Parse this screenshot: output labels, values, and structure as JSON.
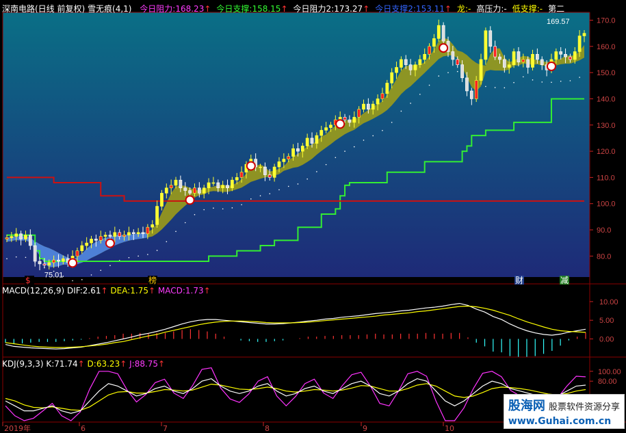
{
  "header": {
    "title": "深南电路(日线 前复权)",
    "indicator": "雪无痕(4,1)",
    "items": [
      {
        "label": "今日阻力:",
        "value": "168.23",
        "arrow": "↑",
        "color": "#ff3cff"
      },
      {
        "label": "今日支撑:",
        "value": "158.15",
        "arrow": "↑",
        "color": "#33ff33"
      },
      {
        "label": "今日阻力2:",
        "value": "173.27",
        "arrow": "↑",
        "color": "#ffffff"
      },
      {
        "label": "今日支撑2:",
        "value": "153.11",
        "arrow": "↑",
        "color": "#3366ff"
      },
      {
        "label": "龙:",
        "value": "-",
        "arrow": "",
        "color": "#ffff00"
      },
      {
        "label": "高压力:",
        "value": "-",
        "arrow": "",
        "color": "#ffffff"
      },
      {
        "label": "低支撑:",
        "value": "-",
        "arrow": "",
        "color": "#ffff00"
      },
      {
        "label": "第二",
        "value": "",
        "arrow": "",
        "color": "#ffffff"
      }
    ]
  },
  "macd_header": {
    "name": "MACD(12,26,9)",
    "dif_label": "DIF:",
    "dif": "2.61",
    "dea_label": "DEA:",
    "dea": "1.75",
    "macd_label": "MACD:",
    "macd": "1.73"
  },
  "kdj_header": {
    "name": "KDJ(9,3,3)",
    "k_label": "K:",
    "k": "71.74",
    "d_label": "D:",
    "d": "63.23",
    "j_label": "J:",
    "j": "88.75"
  },
  "annotations": {
    "max_label": "169.57",
    "min_label": "75.01",
    "bang": "榜",
    "cai": "财",
    "jian": "减",
    "ren": "$"
  },
  "xaxis_labels": [
    "2019年",
    "6",
    "7",
    "8",
    "9",
    "10"
  ],
  "watermark": {
    "brand": "股海网",
    "slogan": "股票软件资源分享",
    "url": "www.Guhai.com.cn"
  },
  "colors": {
    "up": "#ff3333",
    "down": "#33ffff",
    "ma": "#ffffff",
    "resist": "#cc1111",
    "support": "#33ee33",
    "cloud": "#9b9b19",
    "cloud_blue": "#4a7fe0",
    "bg_top": "#0a6f86",
    "bg_bottom": "#1e2a78"
  },
  "chart_data": [
    {
      "type": "candlestick",
      "title": "深南电路(日线 前复权)",
      "yticks": [
        80,
        90,
        100,
        110,
        120,
        130,
        140,
        150,
        160,
        170
      ],
      "ylim": [
        72,
        173
      ],
      "close": [
        87,
        87.5,
        88.5,
        86.5,
        88,
        84,
        78,
        77,
        76.5,
        77.5,
        78.5,
        78,
        79,
        77.5,
        80,
        82,
        84,
        85,
        86.5,
        86,
        87.5,
        88,
        87.5,
        89,
        87.5,
        88,
        89,
        88.5,
        89,
        88.5,
        91,
        92,
        99,
        104,
        106,
        107,
        109,
        106,
        105,
        104,
        106,
        104,
        106,
        108,
        108,
        106,
        107,
        106,
        109,
        110,
        112,
        115,
        117,
        114,
        114,
        111,
        110,
        114,
        116,
        117,
        118,
        121,
        120,
        122,
        125,
        123,
        126,
        128,
        129,
        130,
        132,
        133,
        132,
        131,
        133,
        136,
        138,
        136,
        138,
        140,
        142,
        146,
        150,
        152,
        155,
        153,
        151,
        153,
        155,
        157,
        160,
        163,
        168,
        162,
        158,
        155,
        153,
        148,
        143,
        140,
        147,
        155,
        166,
        160,
        156,
        155,
        152,
        153,
        158,
        154,
        155,
        152,
        157,
        155,
        153,
        151,
        155,
        158,
        157,
        156,
        155,
        158,
        164,
        165
      ],
      "support_line": [
        88,
        88,
        88,
        88,
        88,
        88,
        82,
        79,
        78,
        78,
        78,
        78,
        78,
        78,
        78,
        78,
        78,
        78,
        78,
        78,
        78,
        78,
        78,
        78,
        78,
        78,
        78,
        78,
        78,
        78,
        78,
        78,
        78,
        78,
        78,
        78,
        78,
        78,
        78,
        78,
        78,
        78,
        78,
        80,
        80,
        80,
        80,
        80,
        80,
        82,
        82,
        82,
        82,
        82,
        84,
        84,
        84,
        86,
        86,
        86,
        86,
        86,
        91,
        91,
        91,
        91,
        91,
        96,
        96,
        96,
        98,
        103,
        107,
        108,
        108,
        108,
        108,
        108,
        108,
        108,
        108,
        112,
        112,
        112,
        112,
        112,
        112,
        112,
        112,
        116,
        116,
        116,
        116,
        116,
        116,
        116,
        116,
        120,
        122,
        126,
        126,
        126,
        128,
        128,
        128,
        128,
        128,
        128,
        131,
        131,
        131,
        131,
        131,
        131,
        131,
        131,
        140,
        140,
        140,
        140,
        140,
        140,
        140,
        140,
        140,
        140,
        140,
        140,
        140,
        140,
        140
      ],
      "resist_line": [
        110,
        110,
        110,
        110,
        110,
        110,
        110,
        110,
        110,
        110,
        108,
        108,
        108,
        108,
        108,
        108,
        108,
        108,
        108,
        108,
        103,
        103,
        103,
        103,
        103,
        101,
        101,
        101,
        101,
        101,
        101,
        101,
        101,
        101,
        101,
        101,
        101,
        101,
        101,
        101,
        101,
        101,
        101,
        101,
        101,
        101,
        101,
        101,
        101,
        101,
        101,
        101,
        101,
        101,
        101,
        101,
        101,
        101,
        101,
        101,
        101,
        101,
        101,
        101,
        101,
        101,
        101,
        101,
        101,
        101,
        101,
        101,
        101,
        101,
        101,
        101,
        101,
        101,
        101,
        101,
        101,
        101,
        101,
        101,
        101,
        101,
        101,
        101,
        101,
        101,
        101,
        101,
        101,
        101,
        101,
        101,
        101,
        101,
        101,
        101,
        101,
        101,
        101,
        101,
        101,
        101,
        101,
        101,
        101,
        101,
        101,
        101,
        101,
        101,
        101,
        101,
        101,
        101,
        101,
        101,
        101,
        101,
        101,
        101,
        101
      ],
      "xlabels": [
        "2019年",
        "6",
        "7",
        "8",
        "9",
        "10"
      ]
    },
    {
      "type": "bar",
      "title": "MACD(12,26,9)",
      "yticks": [
        0,
        5,
        10
      ],
      "ylim": [
        -4.5,
        12
      ],
      "dif": [
        -1.5,
        -2,
        -2.2,
        -2.4,
        -2.5,
        -2.6,
        -2.7,
        -2.6,
        -2.4,
        -2.2,
        -1.8,
        -1.4,
        -1,
        -0.5,
        0,
        0.5,
        1.1,
        1.5,
        2,
        2.6,
        3.3,
        4,
        4.6,
        5,
        5.2,
        5.2,
        5,
        4.8,
        4.6,
        4.4,
        4.2,
        4,
        4,
        4.1,
        4.3,
        4.5,
        4.8,
        5,
        5.3,
        5.5,
        5.8,
        6,
        6.2,
        6.5,
        6.8,
        7,
        7.2,
        7.5,
        7.7,
        8,
        8.3,
        8.5,
        8.8,
        9.2,
        9.5,
        9,
        8,
        7.2,
        6,
        5.2,
        4,
        3,
        2.2,
        1.6,
        1.2,
        1,
        1.3,
        1.8,
        2.2,
        2.6
      ],
      "dea": [
        -1,
        -1.3,
        -1.6,
        -1.9,
        -2.1,
        -2.2,
        -2.3,
        -2.3,
        -2.2,
        -2.1,
        -1.9,
        -1.7,
        -1.4,
        -1,
        -0.7,
        -0.2,
        0.3,
        0.8,
        1.2,
        1.8,
        2.3,
        2.8,
        3.3,
        3.8,
        4.2,
        4.5,
        4.7,
        4.8,
        4.8,
        4.7,
        4.6,
        4.4,
        4.3,
        4.3,
        4.3,
        4.4,
        4.5,
        4.7,
        4.9,
        5.1,
        5.3,
        5.5,
        5.7,
        5.9,
        6.1,
        6.4,
        6.6,
        6.8,
        7,
        7.3,
        7.5,
        7.8,
        8.1,
        8.4,
        8.7,
        8.8,
        8.6,
        8.2,
        7.7,
        7,
        6.3,
        5.4,
        4.6,
        3.9,
        3.2,
        2.6,
        2.2,
        2,
        1.9,
        1.75
      ],
      "macd": [
        -1,
        -1.4,
        -1.2,
        -1,
        -0.8,
        -0.8,
        -0.8,
        -0.6,
        -0.4,
        -0.2,
        0.2,
        0.6,
        0.8,
        1,
        1.4,
        1.4,
        1.6,
        1.4,
        1.6,
        1.6,
        2,
        2.4,
        2.6,
        2.4,
        2,
        1.4,
        0.6,
        0,
        -0.4,
        -0.6,
        -0.8,
        -0.8,
        -0.6,
        -0.4,
        0,
        0.2,
        0.6,
        0.6,
        0.8,
        0.8,
        1,
        1,
        1,
        1.2,
        1.4,
        1.2,
        1.2,
        1.4,
        1.4,
        1.4,
        1.6,
        1.4,
        1.4,
        1.6,
        1.6,
        0.4,
        -1,
        -2,
        -3.4,
        -3.6,
        -4.6,
        -4.8,
        -4.8,
        -4.6,
        -4,
        -3.2,
        -1.8,
        -0.4,
        0.6,
        1.73
      ]
    },
    {
      "type": "line",
      "title": "KDJ(9,3,3)",
      "yticks": [
        80,
        100
      ],
      "ylim": [
        0,
        108
      ],
      "k": [
        40,
        30,
        20,
        20,
        25,
        30,
        20,
        15,
        20,
        40,
        60,
        75,
        70,
        60,
        50,
        55,
        65,
        70,
        60,
        55,
        65,
        80,
        85,
        70,
        60,
        55,
        60,
        70,
        75,
        60,
        50,
        55,
        65,
        70,
        60,
        55,
        65,
        75,
        80,
        70,
        55,
        50,
        60,
        75,
        85,
        80,
        60,
        40,
        30,
        40,
        55,
        70,
        80,
        75,
        65,
        60,
        55,
        50,
        45,
        50,
        60,
        70,
        72
      ],
      "d": [
        45,
        40,
        32,
        27,
        26,
        28,
        25,
        22,
        21,
        28,
        40,
        52,
        58,
        59,
        56,
        56,
        59,
        63,
        62,
        60,
        62,
        68,
        74,
        72,
        68,
        64,
        63,
        65,
        68,
        65,
        60,
        58,
        60,
        63,
        62,
        60,
        62,
        66,
        71,
        70,
        65,
        60,
        60,
        65,
        72,
        75,
        70,
        60,
        50,
        47,
        50,
        57,
        65,
        68,
        67,
        65,
        62,
        58,
        54,
        52,
        55,
        60,
        63
      ],
      "j": [
        30,
        10,
        0,
        5,
        20,
        35,
        10,
        0,
        18,
        64,
        100,
        100,
        95,
        62,
        38,
        53,
        77,
        84,
        56,
        45,
        71,
        104,
        107,
        66,
        44,
        37,
        54,
        80,
        89,
        50,
        30,
        49,
        75,
        84,
        56,
        45,
        71,
        93,
        98,
        70,
        35,
        30,
        60,
        95,
        100,
        90,
        40,
        0,
        0,
        26,
        65,
        96,
        100,
        89,
        61,
        50,
        41,
        34,
        27,
        46,
        70,
        90,
        88.75
      ]
    }
  ]
}
